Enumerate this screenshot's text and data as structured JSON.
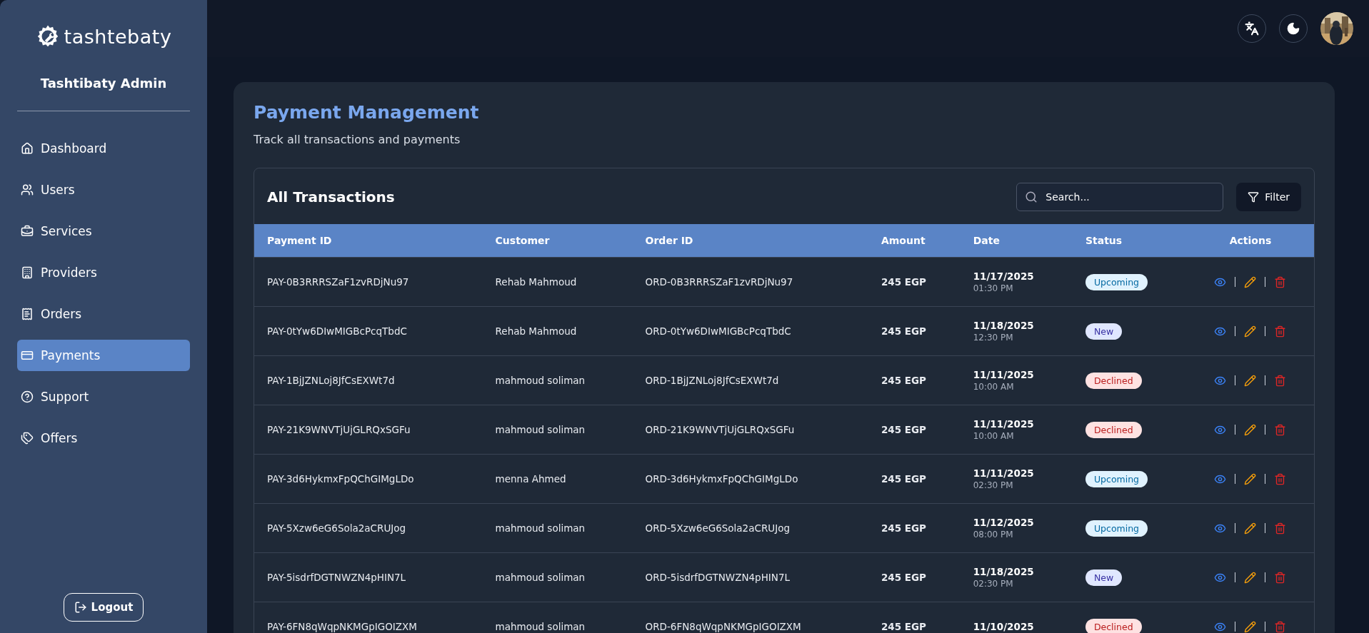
{
  "sidebar": {
    "logo": "tashtebaty",
    "title": "Tashtibaty Admin",
    "items": [
      {
        "label": "Dashboard",
        "selected": false
      },
      {
        "label": "Users",
        "selected": false
      },
      {
        "label": "Services",
        "selected": false
      },
      {
        "label": "Providers",
        "selected": false
      },
      {
        "label": "Orders",
        "selected": false
      },
      {
        "label": "Payments",
        "selected": true
      },
      {
        "label": "Support",
        "selected": false
      },
      {
        "label": "Offers",
        "selected": false
      }
    ],
    "logout": "Logout"
  },
  "page": {
    "title": "Payment Management",
    "subtitle": "Track all transactions and payments"
  },
  "transactions": {
    "title": "All Transactions",
    "search": {
      "placeholder": "Search..."
    },
    "filter": "Filter",
    "columns": [
      "Payment ID",
      "Customer",
      "Order ID",
      "Amount",
      "Date",
      "Status",
      "Actions"
    ],
    "rows": [
      {
        "payment_id": "PAY-0B3RRRSZaF1zvRDjNu97",
        "customer": "Rehab Mahmoud",
        "order_id": "ORD-0B3RRRSZaF1zvRDjNu97",
        "amount": "245 EGP",
        "date": "11/17/2025",
        "time": "01:30 PM",
        "status": "Upcoming",
        "kind": "upcoming"
      },
      {
        "payment_id": "PAY-0tYw6DIwMIGBcPcqTbdC",
        "customer": "Rehab Mahmoud",
        "order_id": "ORD-0tYw6DIwMIGBcPcqTbdC",
        "amount": "245 EGP",
        "date": "11/18/2025",
        "time": "12:30 PM",
        "status": "New",
        "kind": "new"
      },
      {
        "payment_id": "PAY-1BjJZNLoj8JfCsEXWt7d",
        "customer": "mahmoud soliman",
        "order_id": "ORD-1BjJZNLoj8JfCsEXWt7d",
        "amount": "245 EGP",
        "date": "11/11/2025",
        "time": "10:00 AM",
        "status": "Declined",
        "kind": "declined"
      },
      {
        "payment_id": "PAY-21K9WNVTjUjGLRQxSGFu",
        "customer": "mahmoud soliman",
        "order_id": "ORD-21K9WNVTjUjGLRQxSGFu",
        "amount": "245 EGP",
        "date": "11/11/2025",
        "time": "10:00 AM",
        "status": "Declined",
        "kind": "declined"
      },
      {
        "payment_id": "PAY-3d6HykmxFpQChGIMgLDo",
        "customer": "menna Ahmed",
        "order_id": "ORD-3d6HykmxFpQChGIMgLDo",
        "amount": "245 EGP",
        "date": "11/11/2025",
        "time": "02:30 PM",
        "status": "Upcoming",
        "kind": "upcoming"
      },
      {
        "payment_id": "PAY-5Xzw6eG6Sola2aCRUJog",
        "customer": "mahmoud soliman",
        "order_id": "ORD-5Xzw6eG6Sola2aCRUJog",
        "amount": "245 EGP",
        "date": "11/12/2025",
        "time": "08:00 PM",
        "status": "Upcoming",
        "kind": "upcoming"
      },
      {
        "payment_id": "PAY-5isdrfDGTNWZN4pHIN7L",
        "customer": "mahmoud soliman",
        "order_id": "ORD-5isdrfDGTNWZN4pHIN7L",
        "amount": "245 EGP",
        "date": "11/18/2025",
        "time": "02:30 PM",
        "status": "New",
        "kind": "new"
      },
      {
        "payment_id": "PAY-6FN8qWqpNKMGpIGOIZXM",
        "customer": "mahmoud soliman",
        "order_id": "ORD-6FN8qWqpNKMGpIGOIZXM",
        "amount": "245 EGP",
        "date": "11/10/2025",
        "status": "Declined",
        "kind": "declined"
      }
    ]
  }
}
